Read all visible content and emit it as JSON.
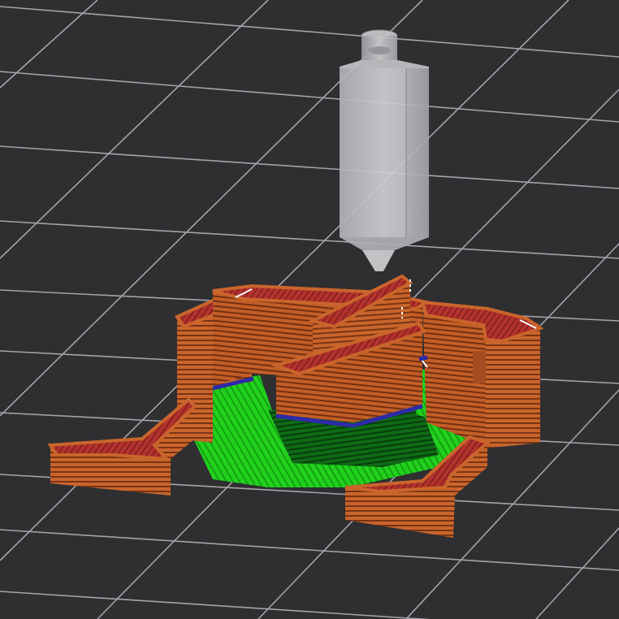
{
  "colors": {
    "background": "#2f2f31",
    "grid_line": "#b9b9bd",
    "perimeter": "#c45f28",
    "perimeter_line": "#7c3515",
    "top_solid": "#b3332e",
    "infill": "#22d11e",
    "infill_dark": "#0c5a12",
    "bridge": "#2e2aa8",
    "nozzle": "#b5b5b8",
    "travel": "#ffffff"
  },
  "scene": {
    "bed_grid_visible": true,
    "nozzle_visible": true,
    "toolpath_features": [
      "perimeter",
      "top-solid-infill",
      "sparse-infill",
      "bridge-infill",
      "travel"
    ]
  }
}
